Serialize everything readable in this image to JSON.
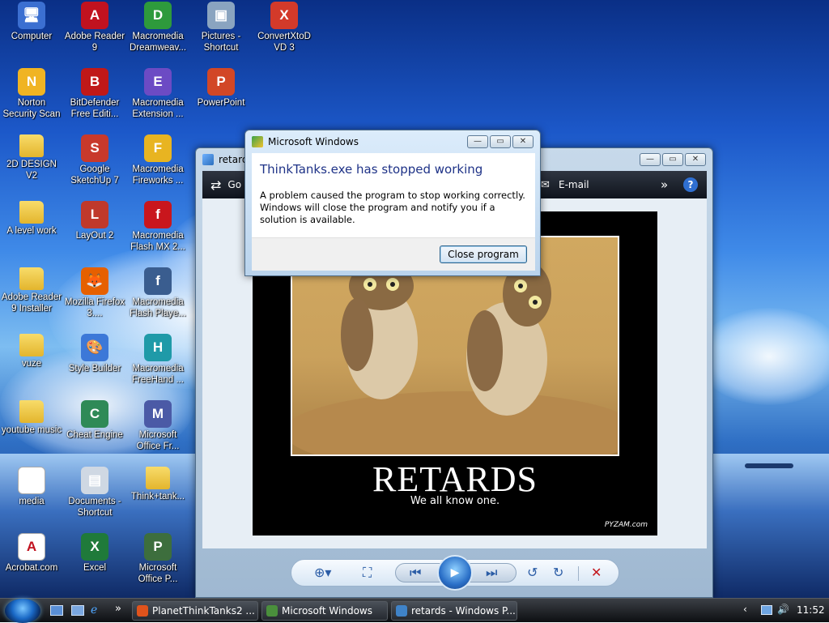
{
  "desktop": {
    "icons": [
      {
        "label": "Computer",
        "color": "#3b6fd1",
        "glyph": "🖥"
      },
      {
        "label": "Adobe Reader 9",
        "color": "#c1121f",
        "glyph": "A"
      },
      {
        "label": "Macromedia Dreamweav...",
        "color": "#2e9a3c",
        "glyph": "D"
      },
      {
        "label": "Pictures - Shortcut",
        "color": "#8aa4c0",
        "glyph": "▣"
      },
      {
        "label": "ConvertXtoD VD 3",
        "color": "#d33a2a",
        "glyph": "X"
      },
      {
        "label": "Norton Security Scan",
        "color": "#f0b423",
        "glyph": "N"
      },
      {
        "label": "BitDefender Free Editi...",
        "color": "#c01818",
        "glyph": "B"
      },
      {
        "label": "Macromedia Extension ...",
        "color": "#6c4bc4",
        "glyph": "E"
      },
      {
        "label": "PowerPoint",
        "color": "#d24726",
        "glyph": "P"
      },
      {
        "label": "2D DESIGN V2",
        "color": "#f0c640",
        "glyph": ""
      },
      {
        "label": "Google SketchUp 7",
        "color": "#c8392b",
        "glyph": "S"
      },
      {
        "label": "Macromedia Fireworks ...",
        "color": "#e8b421",
        "glyph": "F"
      },
      {
        "label": "A level work",
        "color": "#f0c640",
        "glyph": ""
      },
      {
        "label": "LayOut 2",
        "color": "#c0392b",
        "glyph": "L"
      },
      {
        "label": "Macromedia Flash MX 2...",
        "color": "#c9161d",
        "glyph": "f"
      },
      {
        "label": "Adobe Reader 9 Installer",
        "color": "#f0c640",
        "glyph": ""
      },
      {
        "label": "Mozilla Firefox 3....",
        "color": "#e66000",
        "glyph": "🦊"
      },
      {
        "label": "Macromedia Flash Playe...",
        "color": "#3a5d8f",
        "glyph": "f"
      },
      {
        "label": "vuze",
        "color": "#f0c640",
        "glyph": ""
      },
      {
        "label": "Style Builder",
        "color": "#3c78d8",
        "glyph": "🎨"
      },
      {
        "label": "Macromedia FreeHand ...",
        "color": "#1f9aa8",
        "glyph": "H"
      },
      {
        "label": "youtube music",
        "color": "#f0c640",
        "glyph": ""
      },
      {
        "label": "Cheat Engine",
        "color": "#2f8a57",
        "glyph": "C"
      },
      {
        "label": "Microsoft Office Fr...",
        "color": "#4b5aa6",
        "glyph": "M"
      },
      {
        "label": "media",
        "color": "#ffffff",
        "glyph": ""
      },
      {
        "label": "Documents - Shortcut",
        "color": "#cfd8e3",
        "glyph": "▤"
      },
      {
        "label": "Think+tank...",
        "color": "#f0c640",
        "glyph": ""
      },
      {
        "label": "Acrobat.com",
        "color": "#ffffff",
        "glyph": "A"
      },
      {
        "label": "Excel",
        "color": "#1f7a3a",
        "glyph": "X"
      },
      {
        "label": "Microsoft Office P...",
        "color": "#3d6e3d",
        "glyph": "P"
      }
    ]
  },
  "viewer": {
    "title": "retard",
    "toolbar": {
      "go_label": "Go",
      "email_label": "E-mail",
      "more": "»",
      "help": "?"
    },
    "poster": {
      "headline": "RETARDS",
      "tagline": "We all know one.",
      "credit": "PYZAM.com"
    },
    "nav": {
      "zoom": "⊕▾",
      "fit": "⛶",
      "prev": "⏮",
      "slideshow": "▶",
      "next": "⏭",
      "rotate_ccw": "↺",
      "rotate_cw": "↻",
      "delete": "✕"
    }
  },
  "dialog": {
    "title": "Microsoft Windows",
    "heading": "ThinkTanks.exe has stopped working",
    "message": "A problem caused the program to stop working correctly. Windows will close the program and notify you if a solution is available.",
    "button": "Close program"
  },
  "taskbar": {
    "tasks": [
      {
        "label": "PlanetThinkTanks2 ...",
        "color": "#e0531c"
      },
      {
        "label": "Microsoft Windows",
        "color": "#4a8f3c"
      },
      {
        "label": "retards - Windows P...",
        "color": "#3f83c8"
      }
    ],
    "more": "»",
    "tray_expand": "‹",
    "clock": "11:52"
  }
}
